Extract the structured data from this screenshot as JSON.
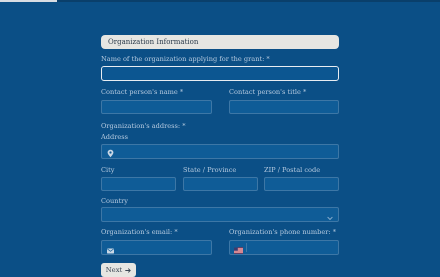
{
  "progress": {
    "fraction": 0.13
  },
  "section": {
    "title": "Organization Information"
  },
  "fields": {
    "org_name": {
      "label": "Name of the organization applying for the grant:",
      "required_mark": "*",
      "value": ""
    },
    "contact_name": {
      "label": "Contact person's name",
      "required_mark": "*",
      "value": ""
    },
    "contact_title": {
      "label": "Contact person's title",
      "required_mark": "*",
      "value": ""
    },
    "address_group": {
      "label": "Organization's address:",
      "required_mark": "*"
    },
    "address": {
      "label": "Address",
      "value": ""
    },
    "city": {
      "label": "City",
      "value": ""
    },
    "state": {
      "label": "State / Province",
      "value": ""
    },
    "zip": {
      "label": "ZIP / Postal code",
      "value": ""
    },
    "country": {
      "label": "Country",
      "value": ""
    },
    "email": {
      "label": "Organization's email:",
      "required_mark": "*",
      "value": ""
    },
    "phone": {
      "label": "Organization's phone number:",
      "required_mark": "*",
      "value": ""
    }
  },
  "icons": {
    "address": "map-pin-icon",
    "country": "chevron-down-icon",
    "email": "envelope-icon",
    "phone": "us-flag-icon",
    "next": "arrow-right-icon"
  },
  "buttons": {
    "next_label": "Next"
  },
  "colors": {
    "background": "#0b4f86",
    "field": "#0f5c97",
    "field_border": "#3d77a6",
    "label": "#b7cbe0",
    "header_bg": "#e6e6e2"
  }
}
